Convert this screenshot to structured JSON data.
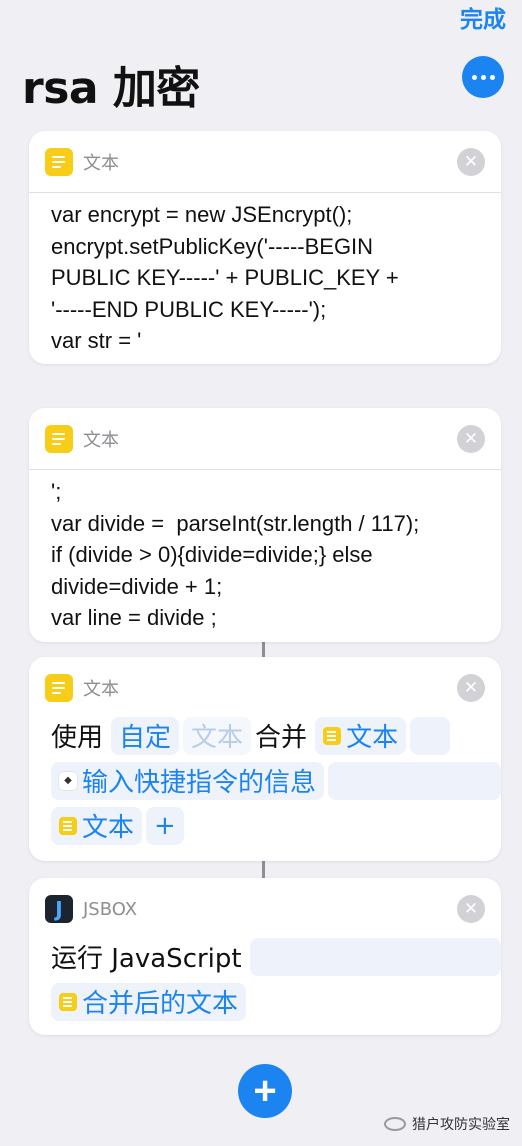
{
  "nav": {
    "done_label": "完成",
    "title": "rsa 加密"
  },
  "cards": [
    {
      "label": "文本",
      "lines": [
        "var encrypt = new JSEncrypt();",
        "encrypt.setPublicKey('-----BEGIN",
        "PUBLIC KEY-----' + PUBLIC_KEY +",
        "'-----END PUBLIC KEY-----');",
        "var str = '"
      ]
    },
    {
      "label": "文本",
      "lines": [
        "';",
        "var divide =  parseInt(str.length / 117);",
        "if (divide > 0){divide=divide;} else",
        "divide=divide + 1;",
        "var line = divide ;"
      ]
    },
    {
      "label": "文本",
      "use_label": "使用",
      "custom_label": "自定",
      "text_placeholder": "文本",
      "merge_label": "合并",
      "text_var": "文本",
      "input_var": "输入快捷指令的信息",
      "text_var2": "文本",
      "plus": "+"
    },
    {
      "label": "JSBOX",
      "icon_letter": "J",
      "action_label": "运行 JavaScript",
      "merged_var": "合并后的文本"
    }
  ],
  "add_button": "+",
  "close_glyph": "✕",
  "watermark": "猎户攻防实验室"
}
